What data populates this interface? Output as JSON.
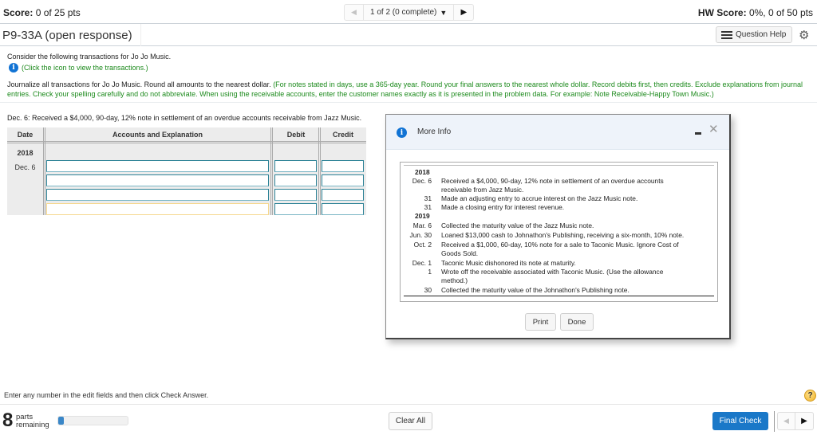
{
  "header": {
    "score_label": "Score:",
    "score_value": "0 of 25 pts",
    "question_nav": {
      "prev_icon": "◀",
      "position": "1 of 2 (0 complete)",
      "dropdown_icon": "▼",
      "next_icon": "▶"
    },
    "hw_score_label": "HW Score:",
    "hw_score_value": "0%, 0 of 50 pts"
  },
  "title_bar": {
    "title": "P9-33A (open response)",
    "question_help_label": "Question Help",
    "gear_icon": "⚙"
  },
  "instructions": {
    "intro": "Consider the following transactions for Jo Jo Music.",
    "info_icon": "i",
    "click_icon_text": "(Click the icon to view the transactions.)",
    "journalize_text": "Journalize all transactions for Jo Jo Music. Round all amounts to the nearest dollar.",
    "journalize_note": "(For notes stated in days, use a 365-day year. Round your final answers to the nearest whole dollar. Record debits first, then credits. Exclude explanations from journal entries. Check your spelling carefully and do not abbreviate. When using the receivable accounts, enter the customer names exactly as it is presented in the problem data. For example: Note Receivable-Happy Town Music.)"
  },
  "journal": {
    "prompt": "Dec. 6: Received a $4,000, 90-day, 12% note in settlement of an overdue accounts receivable from Jazz Music.",
    "columns": [
      "Date",
      "Accounts and Explanation",
      "Debit",
      "Credit"
    ],
    "year": "2018",
    "date": "Dec. 6",
    "rows": [
      {
        "account": "",
        "debit": "",
        "credit": ""
      },
      {
        "account": "",
        "debit": "",
        "credit": ""
      },
      {
        "account": "",
        "debit": "",
        "credit": ""
      },
      {
        "account": "",
        "debit": "",
        "credit": ""
      }
    ]
  },
  "modal": {
    "title": "More Info",
    "minimize_icon": "–",
    "close_icon": "✕",
    "transactions": [
      {
        "year": "2018"
      },
      {
        "date": "Dec. 6",
        "text": "Received a $4,000, 90-day, 12% note in settlement of an overdue accounts",
        "cont": "receivable from Jazz Music."
      },
      {
        "date": "31",
        "text": "Made an adjusting entry to accrue interest on the Jazz Music note."
      },
      {
        "date": "31",
        "text": "Made a closing entry for interest revenue."
      },
      {
        "year": "2019"
      },
      {
        "date": "Mar. 6",
        "text": "Collected the maturity value of the Jazz Music note."
      },
      {
        "date": "Jun. 30",
        "text": "Loaned $13,000 cash to Johnathon's Publishing, receiving a six-month, 10% note."
      },
      {
        "date": "Oct. 2",
        "text": "Received a $1,000, 60-day, 10% note for a sale to Taconic Music. Ignore Cost of",
        "cont": "Goods Sold."
      },
      {
        "date": "Dec. 1",
        "text": "Taconic Music dishonored its note at maturity."
      },
      {
        "date": "1",
        "text": "Wrote off the receivable associated with Taconic Music. (Use the allowance",
        "cont": "method.)"
      },
      {
        "date": "30",
        "text": "Collected the maturity value of the Johnathon's Publishing note."
      }
    ],
    "print_label": "Print",
    "done_label": "Done"
  },
  "footer": {
    "hint": "Enter any number in the edit fields and then click Check Answer.",
    "help_icon": "?",
    "parts_count": "8",
    "parts_label_1": "parts",
    "parts_label_2": "remaining",
    "progress_fraction": 0.08,
    "clear_all_label": "Clear All",
    "final_check_label": "Final Check",
    "prev_icon": "◀",
    "next_icon": "▶"
  }
}
